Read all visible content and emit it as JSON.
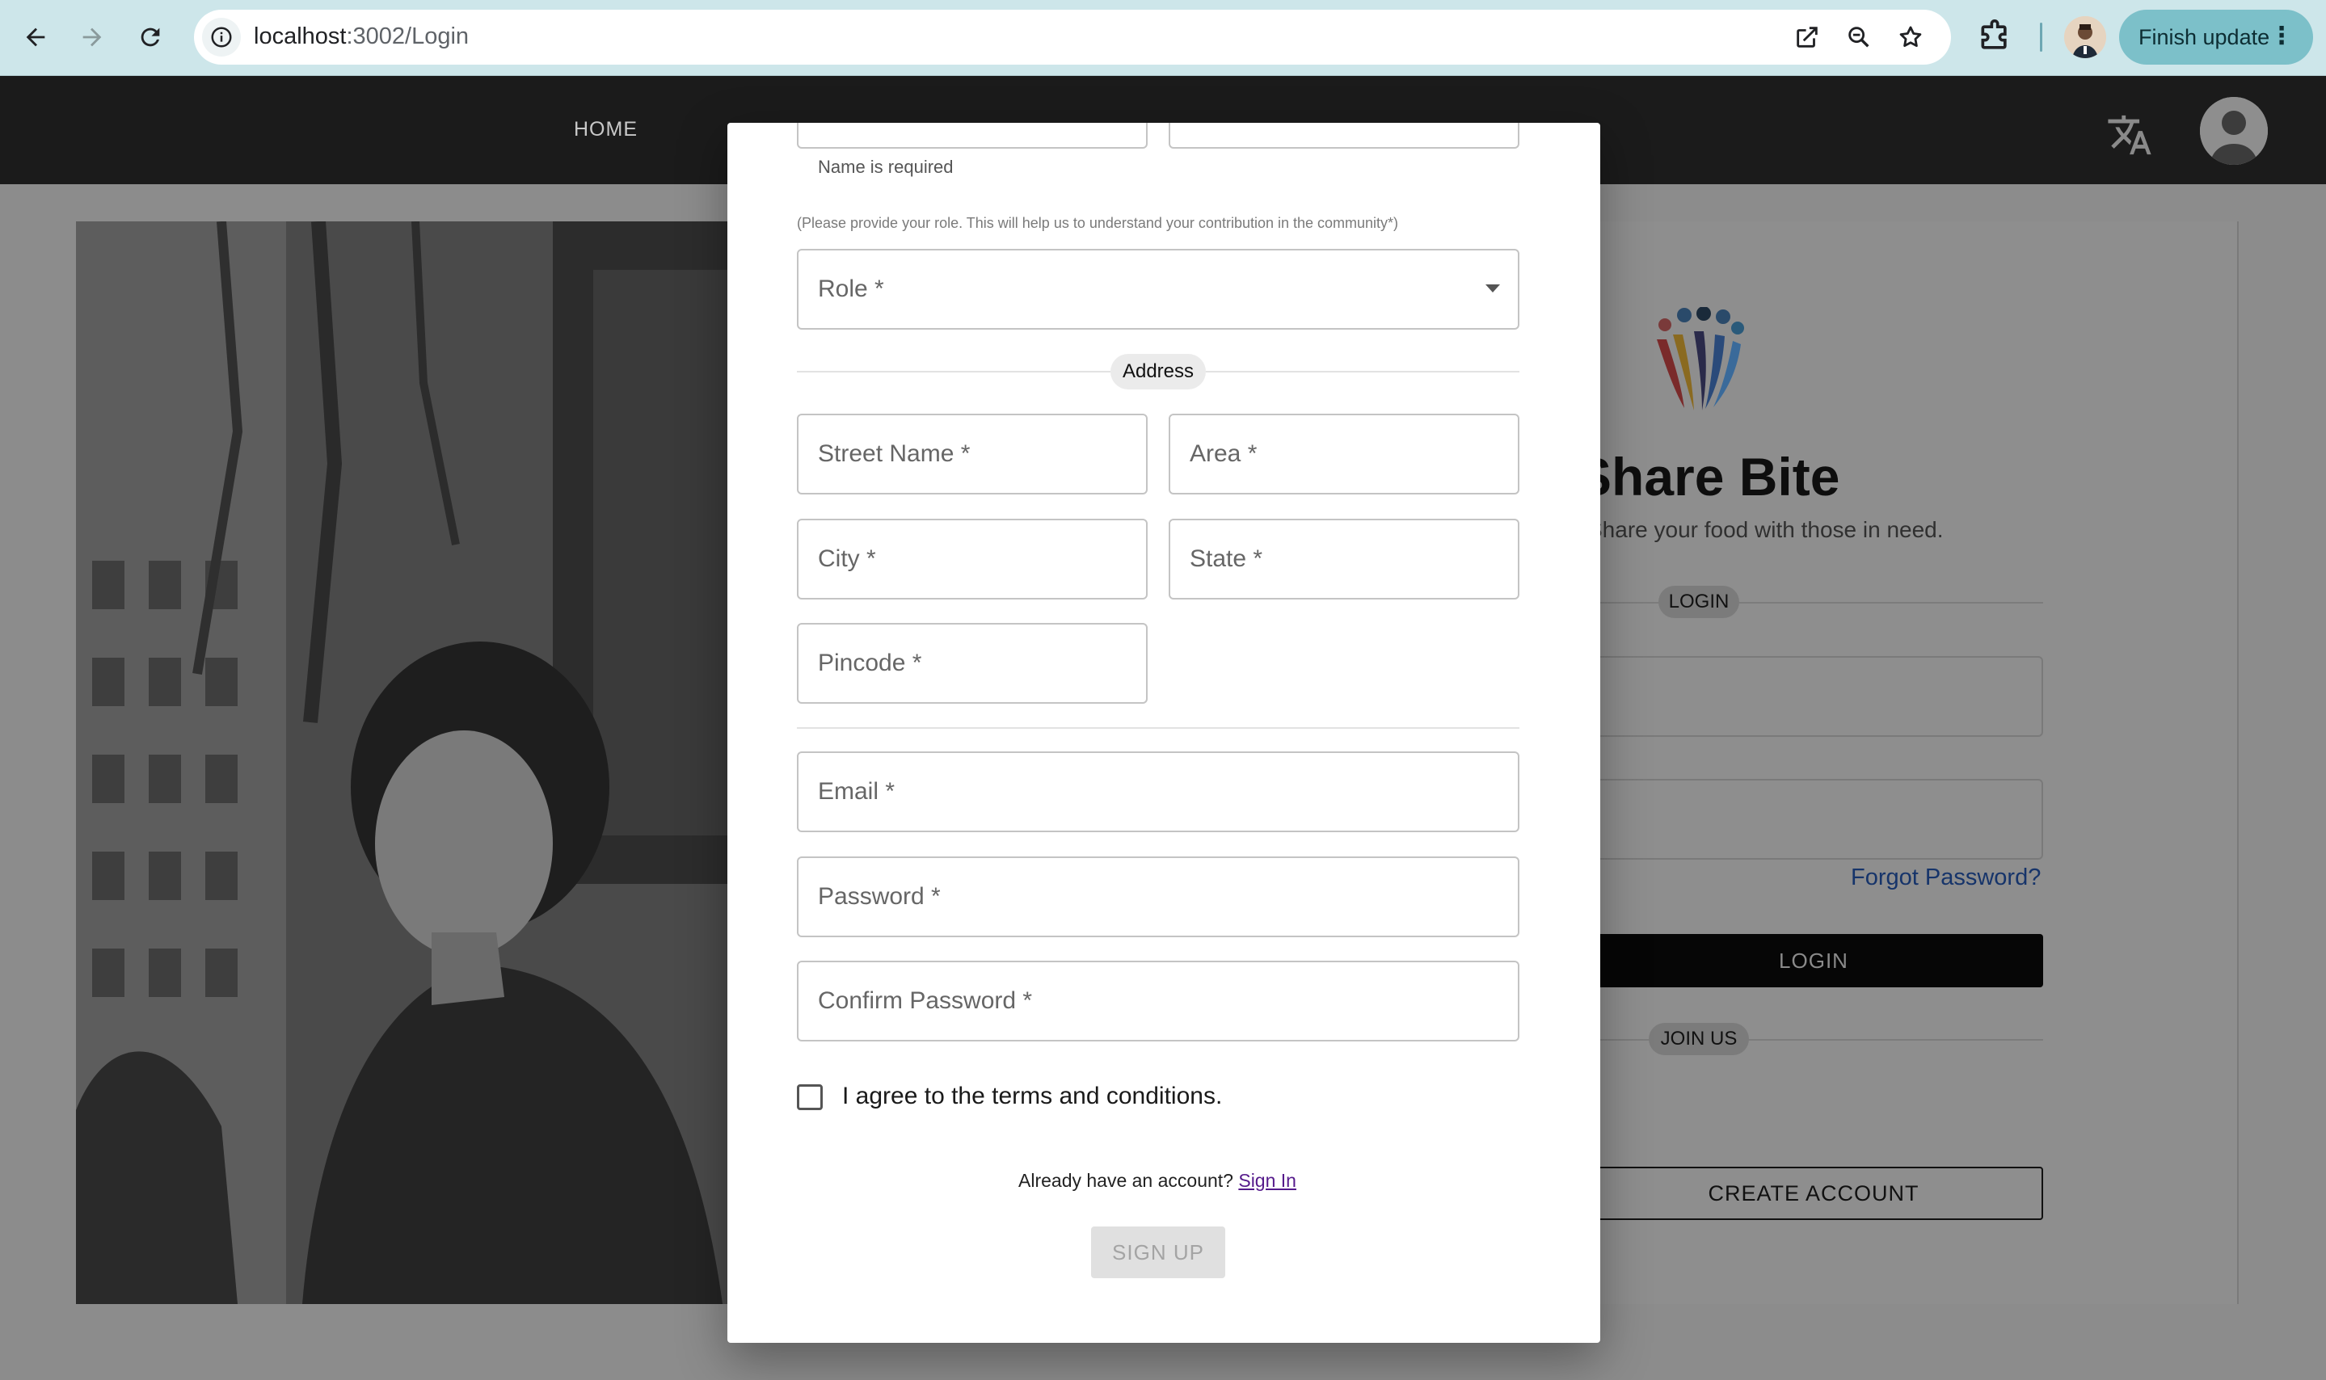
{
  "browser": {
    "url_host": "localhost",
    "url_path": ":3002/Login",
    "finish_update": "Finish update",
    "menu_glyph": "⋮"
  },
  "appbar": {
    "home": "HOME"
  },
  "login_card": {
    "brand_name": "Share Bite",
    "tagline": "Share your food with those in need.",
    "login_divider": "LOGIN",
    "forgot_password": "Forgot Password?",
    "login_button": "LOGIN",
    "join_divider": "JOIN US",
    "create_account": "CREATE ACCOUNT"
  },
  "signup": {
    "name_helper": "Name is required",
    "role_note": "(Please provide your role. This will help us to understand your contribution in the community*)",
    "role_label": "Role *",
    "address_divider": "Address",
    "street_label": "Street Name *",
    "area_label": "Area *",
    "city_label": "City *",
    "state_label": "State *",
    "pincode_label": "Pincode *",
    "email_label": "Email *",
    "password_label": "Password *",
    "confirm_label": "Confirm Password *",
    "agree_text": "I agree to the terms and conditions.",
    "already_text": "Already have an account?",
    "sign_in": "Sign In",
    "sign_up": "SIGN UP"
  },
  "colors": {
    "appbar": "#1b1b1b",
    "overlay_dim": "#8c8c8c",
    "chrome": "#cde6ea",
    "finish_update_bg": "#7cc0c9",
    "link_purple": "#551a8b"
  }
}
